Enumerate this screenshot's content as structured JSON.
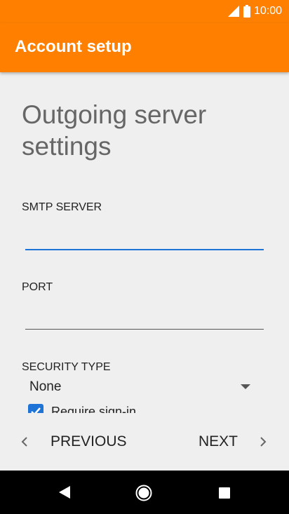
{
  "status_bar": {
    "time": "10:00",
    "signal_icon": "signal-icon",
    "battery_icon": "battery-icon"
  },
  "app_bar": {
    "title": "Account setup"
  },
  "page": {
    "heading": "Outgoing server settings"
  },
  "form": {
    "smtp_server": {
      "label": "SMTP SERVER",
      "value": ""
    },
    "port": {
      "label": "PORT",
      "value": ""
    },
    "security_type": {
      "label": "SECURITY TYPE",
      "selected": "None"
    },
    "require_sign_in": {
      "label": "Require sign-in",
      "checked": true
    }
  },
  "navigation": {
    "previous_label": "PREVIOUS",
    "next_label": "NEXT",
    "previous_icon": "chevron-left-icon",
    "next_icon": "chevron-right-icon"
  },
  "system_nav": {
    "back_icon": "back-icon",
    "home_icon": "home-icon",
    "recents_icon": "recents-icon"
  },
  "colors": {
    "accent": "#ff8000",
    "focus_underline": "#1e73d6",
    "checkbox": "#1e73d6",
    "background": "#efefef"
  }
}
